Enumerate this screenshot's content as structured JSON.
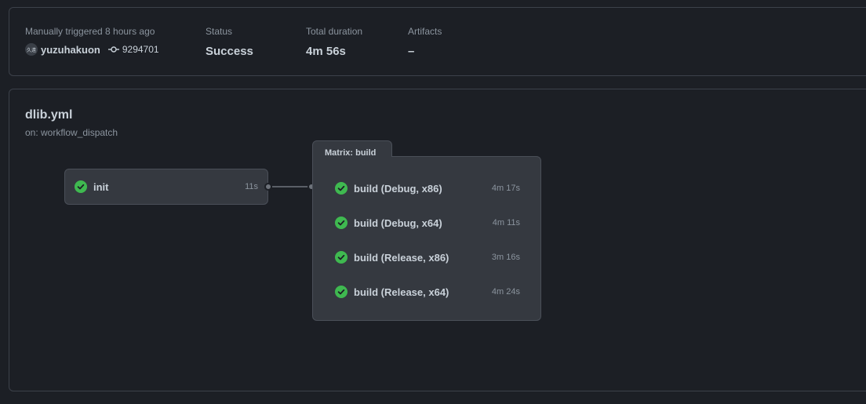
{
  "summary": {
    "trigger_label": "Manually triggered 8 hours ago",
    "avatar_text": "久遠",
    "username": "yuzuhakuon",
    "commit": "9294701",
    "status_label": "Status",
    "status_value": "Success",
    "duration_label": "Total duration",
    "duration_value": "4m 56s",
    "artifacts_label": "Artifacts",
    "artifacts_value": "–"
  },
  "workflow": {
    "file": "dlib.yml",
    "trigger": "on: workflow_dispatch"
  },
  "jobs": {
    "init": {
      "name": "init",
      "duration": "11s",
      "status": "success"
    }
  },
  "matrix": {
    "title": "Matrix: build",
    "items": [
      {
        "name": "build (Debug, x86)",
        "duration": "4m 17s",
        "status": "success"
      },
      {
        "name": "build (Debug, x64)",
        "duration": "4m 11s",
        "status": "success"
      },
      {
        "name": "build (Release, x86)",
        "duration": "3m 16s",
        "status": "success"
      },
      {
        "name": "build (Release, x64)",
        "duration": "4m 24s",
        "status": "success"
      }
    ]
  },
  "colors": {
    "success": "#3fb950",
    "background": "#1c1f25",
    "card": "#353940",
    "border": "#4a4f58"
  },
  "icons": {
    "status": "check-circle-icon",
    "commit": "git-commit-icon"
  }
}
